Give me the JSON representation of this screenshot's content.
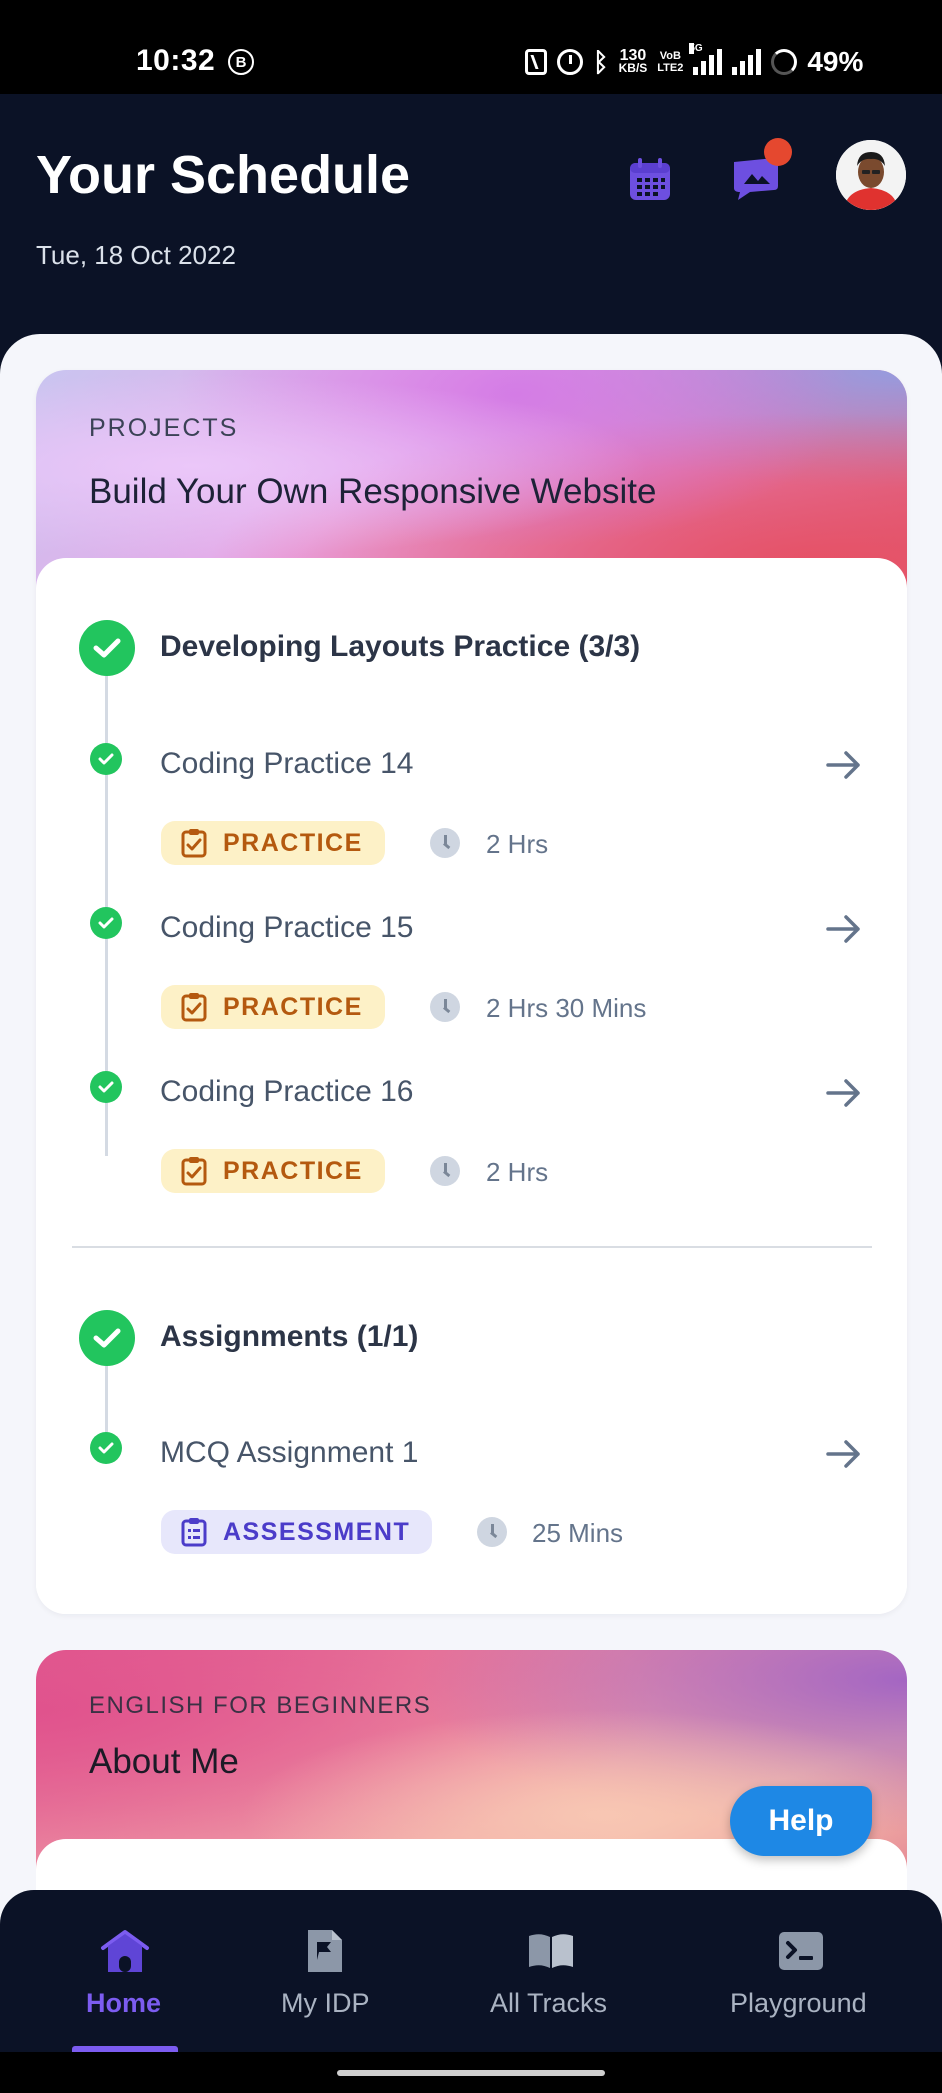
{
  "status_bar": {
    "time": "10:32",
    "b_icon": "B",
    "net_speed_value": "130",
    "net_speed_unit": "KB/S",
    "volte_top": "VoB",
    "volte_bottom": "LTE2",
    "network_5g": "5G",
    "battery": "49%"
  },
  "header": {
    "title": "Your Schedule",
    "date": "Tue, 18 Oct 2022",
    "icons": [
      "calendar-icon",
      "chat-icon",
      "avatar"
    ],
    "notification_dot_color": "#e5482f"
  },
  "project_card": {
    "label": "PROJECTS",
    "title": "Build Your Own Responsive Website",
    "sections": [
      {
        "title": "Developing Layouts Practice (3/3)",
        "items": [
          {
            "title": "Coding Practice 14",
            "badge": "PRACTICE",
            "duration": "2 Hrs"
          },
          {
            "title": "Coding Practice 15",
            "badge": "PRACTICE",
            "duration": "2 Hrs 30 Mins"
          },
          {
            "title": "Coding Practice 16",
            "badge": "PRACTICE",
            "duration": "2 Hrs"
          }
        ]
      },
      {
        "title": "Assignments (1/1)",
        "items": [
          {
            "title": "MCQ Assignment 1",
            "badge": "ASSESSMENT",
            "duration": "25 Mins"
          }
        ]
      }
    ]
  },
  "english_card": {
    "label": "ENGLISH FOR BEGINNERS",
    "title": "About Me"
  },
  "help_button": "Help",
  "bottom_nav": {
    "items": [
      {
        "label": "Home",
        "icon": "home-icon",
        "active": true
      },
      {
        "label": "My IDP",
        "icon": "flag-document-icon",
        "active": false
      },
      {
        "label": "All Tracks",
        "icon": "open-book-icon",
        "active": false
      },
      {
        "label": "Playground",
        "icon": "terminal-icon",
        "active": false
      }
    ]
  },
  "colors": {
    "header_bg": "#0b1226",
    "success_green": "#22c55e",
    "accent_purple": "#7c5cf0",
    "practice_badge_bg": "#fdf1c7",
    "practice_badge_text": "#b4590f",
    "assessment_badge_bg": "#e7e7fb",
    "assessment_badge_text": "#4b3cc9",
    "help_blue": "#1e88e5"
  }
}
